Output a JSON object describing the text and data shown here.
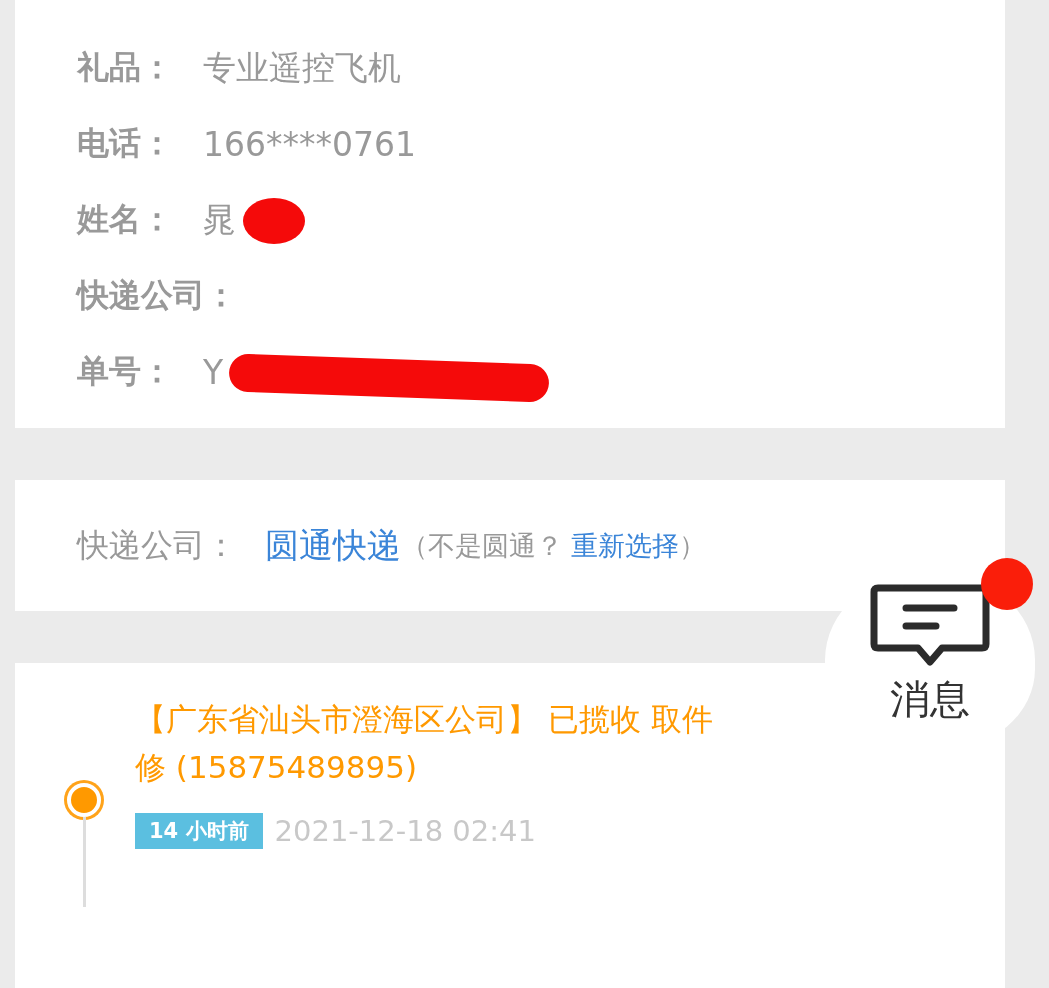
{
  "info_rows": [
    {
      "label": "礼品：",
      "value": "专业遥控飞机",
      "redacted": false
    },
    {
      "label": "电话：",
      "value": "166****0761",
      "redacted": false
    },
    {
      "label": "姓名：",
      "value": "晁",
      "redacted": true
    },
    {
      "label": "快递公司：",
      "value": "",
      "redacted": false
    },
    {
      "label": "单号：",
      "value": "Y",
      "redacted": true
    }
  ],
  "courier": {
    "label": "快递公司：",
    "company": "圆通快递",
    "note": "（不是圆通？",
    "link": "重新选择",
    "note_end": "）"
  },
  "tracking": [
    {
      "lines": [
        "【广东省汕头市澄海区公司】 已揽收 取件",
        "修 (15875489895)"
      ],
      "badge": "14 小时前",
      "time": "2021-12-18 02:41",
      "selected": true
    }
  ],
  "message_button": {
    "label": "消息",
    "unread": true
  }
}
